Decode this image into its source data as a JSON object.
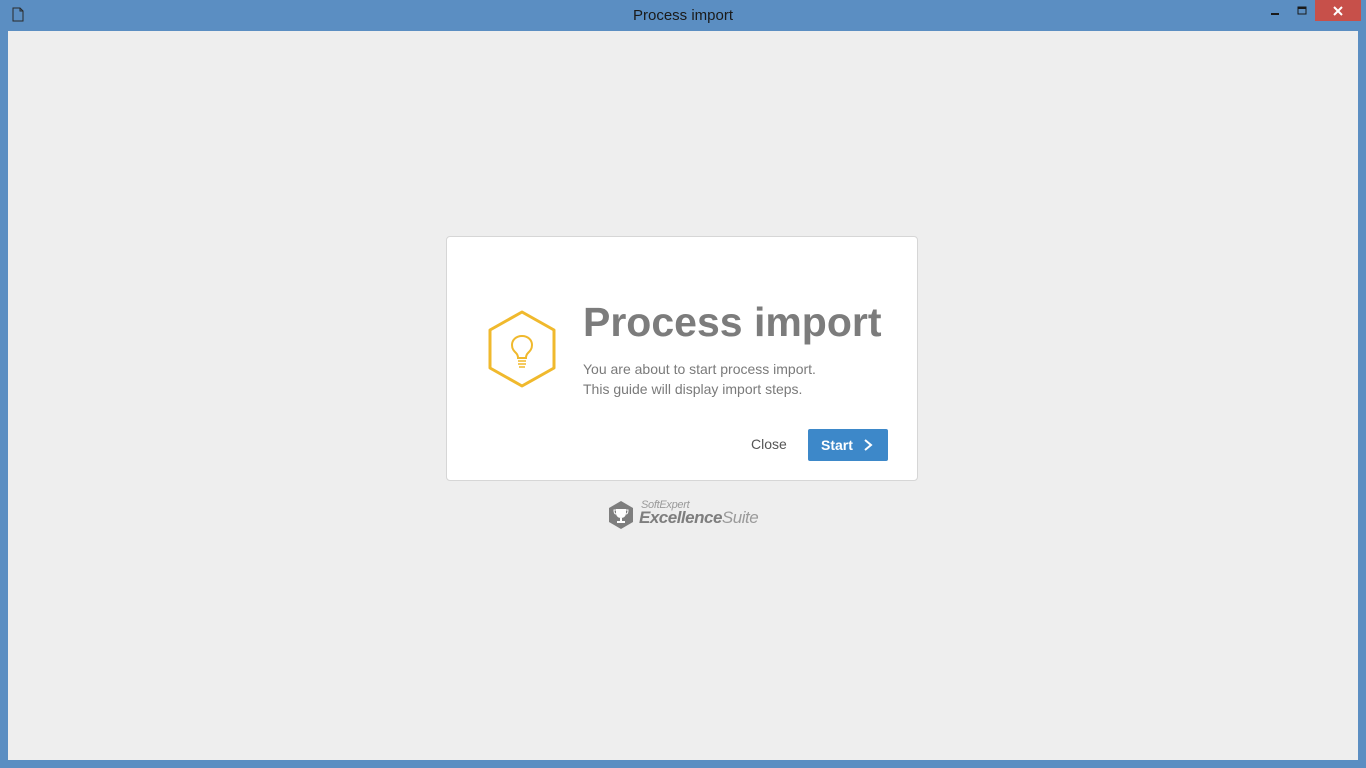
{
  "window": {
    "title": "Process import"
  },
  "dialog": {
    "title": "Process import",
    "description_line1": "You are about to start process import.",
    "description_line2": "This guide will display import steps.",
    "close_label": "Close",
    "start_label": "Start",
    "icon": "lightbulb-hexagon-icon"
  },
  "brand": {
    "small": "SoftExpert",
    "main": "Excellence",
    "suite": "Suite"
  },
  "colors": {
    "accent": "#3d88c9",
    "icon": "#f0b92d",
    "titlebar": "#5b8ec2",
    "close_button": "#c7504a"
  }
}
